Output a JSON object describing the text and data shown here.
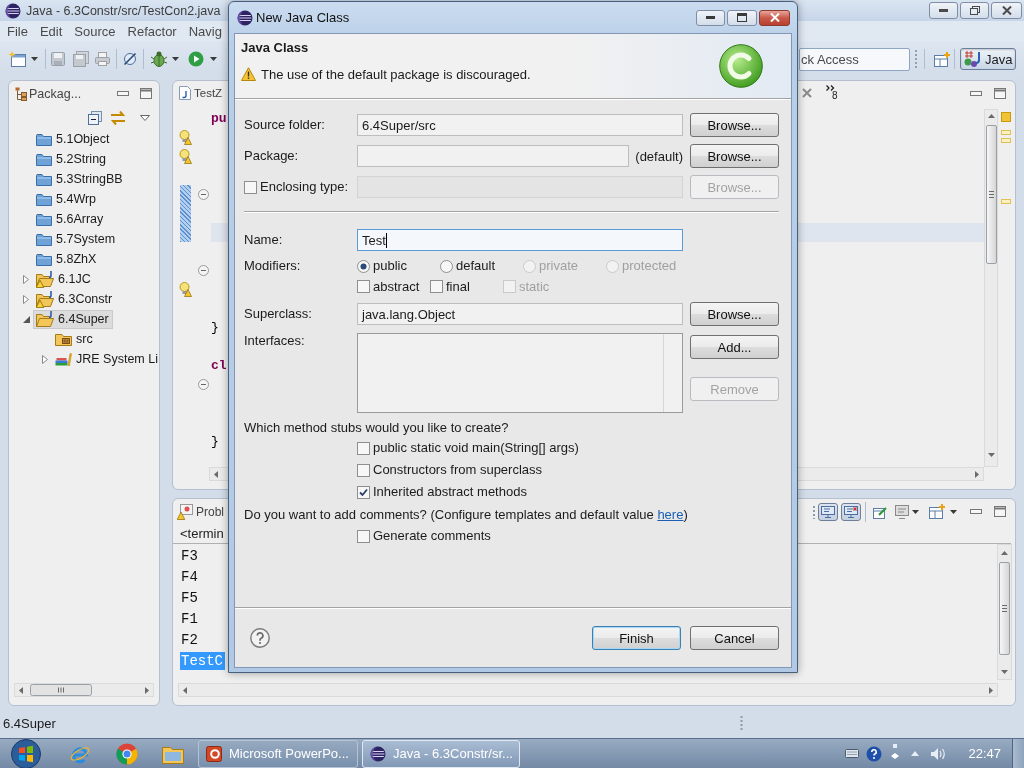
{
  "window": {
    "title": "Java - 6.3Constr/src/TestCon2.java"
  },
  "menu": [
    {
      "label": "File"
    },
    {
      "label": "Edit"
    },
    {
      "label": "Source"
    },
    {
      "label": "Refactor"
    },
    {
      "label": "Navig"
    }
  ],
  "toolbar": {
    "quick_access": {
      "placeholder": "ck Access"
    },
    "perspectives": [
      {
        "label": "Java",
        "selected": true
      }
    ]
  },
  "package_explorer": {
    "title": "Packag...",
    "items": [
      {
        "label": "5.1Object",
        "kind": "folder",
        "selected": false
      },
      {
        "label": "5.2String",
        "kind": "folder",
        "selected": false
      },
      {
        "label": "5.3StringBB",
        "kind": "folder",
        "selected": false
      },
      {
        "label": "5.4Wrp",
        "kind": "folder",
        "selected": false
      },
      {
        "label": "5.6Array",
        "kind": "folder",
        "selected": false
      },
      {
        "label": "5.7System",
        "kind": "folder",
        "selected": false
      },
      {
        "label": "5.8ZhX",
        "kind": "folder",
        "selected": false
      },
      {
        "label": "6.1JC",
        "kind": "project",
        "warning": true,
        "expanded": false,
        "selected": false
      },
      {
        "label": "6.3Constr",
        "kind": "project",
        "warning": true,
        "expanded": false,
        "selected": false
      },
      {
        "label": "6.4Super",
        "kind": "project",
        "warning": false,
        "expanded": true,
        "selected": true,
        "children": [
          {
            "label": "src",
            "kind": "source",
            "selected": false
          },
          {
            "label": "JRE System Li",
            "kind": "library",
            "expanded": false,
            "selected": false
          }
        ]
      }
    ]
  },
  "editor": {
    "tab": "TestZ",
    "hidden_tabs": "8",
    "lines": [
      {
        "kind": "keyword",
        "text": "pu",
        "warning": false,
        "fold": false,
        "in_range": false,
        "current": false
      },
      {
        "kind": "blank",
        "warning": true,
        "fold": false,
        "in_range": false,
        "current": false
      },
      {
        "kind": "blank",
        "warning": true,
        "fold": false,
        "in_range": false,
        "current": false
      },
      {
        "kind": "blank",
        "warning": false,
        "fold": false,
        "in_range": false,
        "current": false
      },
      {
        "kind": "blank",
        "warning": false,
        "fold": true,
        "in_range": true,
        "current": false
      },
      {
        "kind": "blank",
        "warning": false,
        "fold": false,
        "in_range": true,
        "current": false
      },
      {
        "kind": "blank",
        "warning": false,
        "fold": false,
        "in_range": true,
        "current": true
      },
      {
        "kind": "blank",
        "warning": false,
        "fold": false,
        "in_range": false,
        "current": false
      },
      {
        "kind": "blank",
        "warning": false,
        "fold": true,
        "in_range": false,
        "current": false
      },
      {
        "kind": "blank",
        "warning": true,
        "fold": false,
        "in_range": false,
        "current": false
      },
      {
        "kind": "blank",
        "warning": false,
        "fold": false,
        "in_range": false,
        "current": false
      },
      {
        "kind": "plain",
        "text": "}",
        "warning": false,
        "fold": false,
        "in_range": false,
        "current": false
      },
      {
        "kind": "blank",
        "warning": false,
        "fold": false,
        "in_range": false,
        "current": false
      },
      {
        "kind": "keyword",
        "text": "cl",
        "warning": false,
        "fold": false,
        "in_range": false,
        "current": false
      },
      {
        "kind": "blank",
        "warning": false,
        "fold": true,
        "in_range": false,
        "current": false
      },
      {
        "kind": "blank",
        "warning": false,
        "fold": false,
        "in_range": false,
        "current": false
      },
      {
        "kind": "blank",
        "warning": false,
        "fold": false,
        "in_range": false,
        "current": false
      },
      {
        "kind": "plain",
        "text": "}",
        "warning": false,
        "fold": false,
        "in_range": false,
        "current": false
      }
    ]
  },
  "console": {
    "tab": "Probl",
    "header": "<termin",
    "lines": [
      {
        "text": "F3",
        "selected": false
      },
      {
        "text": "F4",
        "selected": false
      },
      {
        "text": "F5",
        "selected": false
      },
      {
        "text": "F1",
        "selected": false
      },
      {
        "text": "F2",
        "selected": false
      },
      {
        "text": "TestC",
        "selected": true
      }
    ]
  },
  "status_bar": {
    "text": "6.4Super"
  },
  "taskbar": {
    "buttons": [
      {
        "kind": "powerpoint",
        "label": "Microsoft PowerPo...",
        "selected": false
      },
      {
        "kind": "eclipse",
        "label": "Java - 6.3Constr/sr...",
        "selected": true
      }
    ],
    "clock": "22:47"
  },
  "dialog": {
    "title": "New Java Class",
    "heading": "Java Class",
    "message": {
      "kind": "warning",
      "text": "The use of the default package is discouraged."
    },
    "rows": [
      {
        "kind": "text",
        "label": "Source folder:",
        "value": "6.4Super/src",
        "focused": false,
        "disabled": false,
        "button": {
          "label": "Browse...",
          "disabled": false
        }
      },
      {
        "kind": "text",
        "label": "Package:",
        "suffix": "(default)",
        "focused": false,
        "disabled": false,
        "button": {
          "label": "Browse...",
          "disabled": false
        }
      },
      {
        "kind": "check_text",
        "label": "Enclosing type:",
        "checked": false,
        "focused": false,
        "disabled": true,
        "button": {
          "label": "Browse...",
          "disabled": true
        }
      },
      {
        "kind": "separator"
      },
      {
        "kind": "text",
        "label": "Name:",
        "value": "Test",
        "focused": true,
        "disabled": false
      },
      {
        "kind": "radios",
        "label": "Modifiers:",
        "options": [
          {
            "label": "public",
            "selected": true,
            "disabled": false
          },
          {
            "label": "default",
            "selected": false,
            "disabled": false
          },
          {
            "label": "private",
            "selected": false,
            "disabled": true
          },
          {
            "label": "protected",
            "selected": false,
            "disabled": true
          }
        ]
      },
      {
        "kind": "checks",
        "options": [
          {
            "label": "abstract",
            "checked": false,
            "disabled": false
          },
          {
            "label": "final",
            "checked": false,
            "disabled": false
          },
          {
            "label": "static",
            "checked": false,
            "disabled": true
          }
        ]
      },
      {
        "kind": "text",
        "label": "Superclass:",
        "value": "java.lang.Object",
        "focused": false,
        "disabled": false,
        "button": {
          "label": "Browse...",
          "disabled": false
        }
      },
      {
        "kind": "list",
        "label": "Interfaces:",
        "buttons": [
          {
            "label": "Add...",
            "disabled": false
          },
          {
            "label": "Remove",
            "disabled": true
          }
        ]
      },
      {
        "kind": "question",
        "text": "Which method stubs would you like to create?"
      },
      {
        "kind": "check",
        "label": "public static void main(String[] args)",
        "checked": false
      },
      {
        "kind": "check",
        "label": "Constructors from superclass",
        "checked": false
      },
      {
        "kind": "check",
        "label": "Inherited abstract methods",
        "checked": true
      },
      {
        "kind": "link_question",
        "text": "Do you want to add comments? (Configure templates and default value",
        "link": "here",
        "after": ")"
      },
      {
        "kind": "check",
        "label": "Generate comments",
        "checked": false
      }
    ],
    "buttons": [
      {
        "label": "Finish",
        "default": true
      },
      {
        "label": "Cancel",
        "default": false
      }
    ]
  }
}
